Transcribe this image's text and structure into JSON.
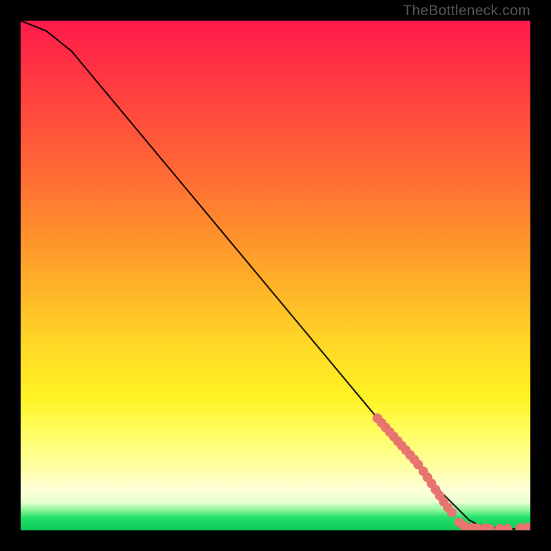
{
  "watermark": "TheBottleneck.com",
  "chart_data": {
    "type": "line",
    "title": "",
    "xlabel": "",
    "ylabel": "",
    "xlim": [
      0,
      100
    ],
    "ylim": [
      0,
      100
    ],
    "grid": false,
    "legend": false,
    "series": [
      {
        "name": "curve",
        "x": [
          0,
          5,
          10,
          15,
          20,
          25,
          30,
          35,
          40,
          45,
          50,
          55,
          60,
          65,
          70,
          75,
          80,
          85,
          88,
          90,
          92,
          94,
          96,
          98,
          100
        ],
        "y": [
          100,
          98,
          94,
          88,
          82,
          76,
          70,
          64,
          58,
          52,
          46,
          40,
          34,
          28,
          22,
          16,
          10,
          5,
          2,
          1,
          0.6,
          0.4,
          0.3,
          0.2,
          0.5
        ],
        "stroke": "#000000",
        "stroke_width": 2
      }
    ],
    "markers": [
      {
        "x": 70.0,
        "y": 22.0
      },
      {
        "x": 70.8,
        "y": 21.1
      },
      {
        "x": 71.6,
        "y": 20.2
      },
      {
        "x": 72.4,
        "y": 19.3
      },
      {
        "x": 73.2,
        "y": 18.4
      },
      {
        "x": 74.0,
        "y": 17.5
      },
      {
        "x": 74.8,
        "y": 16.6
      },
      {
        "x": 75.6,
        "y": 15.7
      },
      {
        "x": 76.4,
        "y": 14.8
      },
      {
        "x": 77.2,
        "y": 13.9
      },
      {
        "x": 78.0,
        "y": 12.9
      },
      {
        "x": 79.0,
        "y": 11.6
      },
      {
        "x": 79.8,
        "y": 10.4
      },
      {
        "x": 80.6,
        "y": 9.2
      },
      {
        "x": 81.4,
        "y": 8.0
      },
      {
        "x": 82.2,
        "y": 6.8
      },
      {
        "x": 83.0,
        "y": 5.6
      },
      {
        "x": 83.8,
        "y": 4.5
      },
      {
        "x": 84.6,
        "y": 3.5
      },
      {
        "x": 86.0,
        "y": 1.6
      },
      {
        "x": 87.0,
        "y": 0.9
      },
      {
        "x": 88.5,
        "y": 0.5
      },
      {
        "x": 89.5,
        "y": 0.4
      },
      {
        "x": 91.0,
        "y": 0.4
      },
      {
        "x": 92.0,
        "y": 0.3
      },
      {
        "x": 94.0,
        "y": 0.3
      },
      {
        "x": 95.5,
        "y": 0.3
      },
      {
        "x": 98.0,
        "y": 0.4
      },
      {
        "x": 99.5,
        "y": 0.6
      }
    ],
    "marker_style": {
      "fill": "#e87470",
      "radius": 7
    }
  }
}
